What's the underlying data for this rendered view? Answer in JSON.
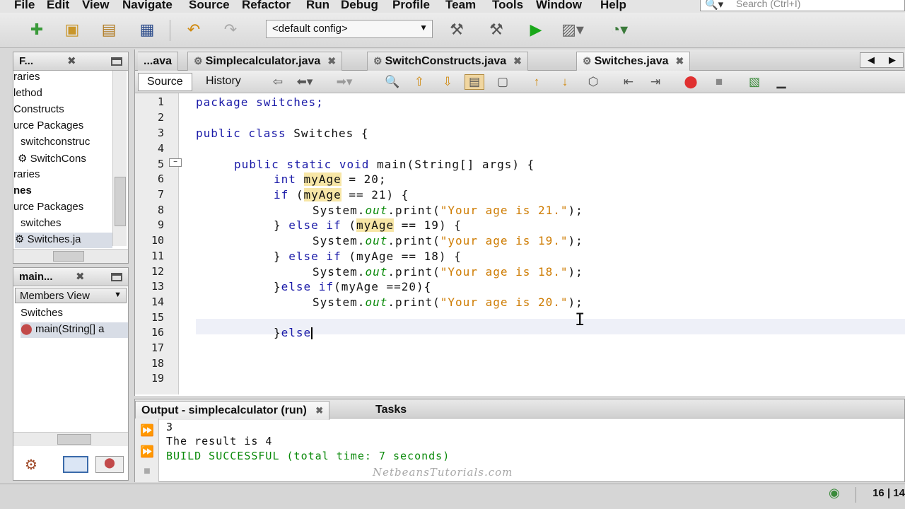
{
  "menu": [
    "File",
    "Edit",
    "View",
    "Navigate",
    "Source",
    "Refactor",
    "Run",
    "Debug",
    "Profile",
    "Team",
    "Tools",
    "Window",
    "Help"
  ],
  "search": {
    "placeholder": "Search (Ctrl+I)"
  },
  "toolbar": {
    "config": "<default config>"
  },
  "projects_panel": {
    "title": "F...",
    "items": [
      "raries",
      "lethod",
      "Constructs",
      "urce Packages",
      "switchconstruc",
      "SwitchCons",
      "raries",
      "nes",
      "urce Packages",
      "switches",
      "Switches.ja"
    ]
  },
  "navigator_panel": {
    "title": "main...",
    "view": "Members View",
    "items": [
      "Switches",
      "main(String[] a"
    ]
  },
  "editor": {
    "tabs": [
      "...ava",
      "Simplecalculator.java",
      "SwitchConstructs.java",
      "Switches.java"
    ],
    "active_tab": "Switches.java",
    "source_tab": "Source",
    "history_tab": "History",
    "line_numbers": [
      "1",
      "2",
      "3",
      "4",
      "5",
      "6",
      "7",
      "8",
      "9",
      "10",
      "11",
      "12",
      "13",
      "14",
      "15",
      "16",
      "17",
      "18",
      "19"
    ],
    "code": {
      "l1": "package switches;",
      "l3_kw": "public class",
      "l3_rest": " Switches {",
      "l5_kw": "public static void",
      "l5_rest": " main(String[] args) {",
      "l6_kw": "int",
      "l6_var": "myAge",
      "l6_rest": " = 20;",
      "l7_kw": "if",
      "l7_a": " (",
      "l7_var": "myAge",
      "l7_rest": " == 21) {",
      "sys": "System.",
      "out": "out",
      "print": ".print(",
      "l8_str": "\"Your age is 21.\"",
      "end": ");",
      "l9_a": "} ",
      "l9_kw": "else if",
      "l9_b": " (",
      "l9_var": "myAge",
      "l9_rest": " == 19) {",
      "l10_str": "\"your age is 19.\"",
      "l11_a": "} ",
      "l11_kw": "else if",
      "l11_rest": " (myAge == 18) {",
      "l12_str": "\"Your age is 18.\"",
      "l13_a": "}",
      "l13_kw": "else if",
      "l13_rest": "(myAge ==20){",
      "l14_str": "\"Your age is 20.\"",
      "l16_a": "}",
      "l16_kw": "else"
    }
  },
  "output": {
    "title": "Output - simplecalculator (run)",
    "tasks_tab": "Tasks",
    "lines": [
      "3",
      "The result is 4",
      "BUILD SUCCESSFUL (total time: 7 seconds)"
    ],
    "success_color": "#0a8a0a",
    "watermark": "NetbeansTutorials.com"
  },
  "status": {
    "position": "16 | 14"
  }
}
